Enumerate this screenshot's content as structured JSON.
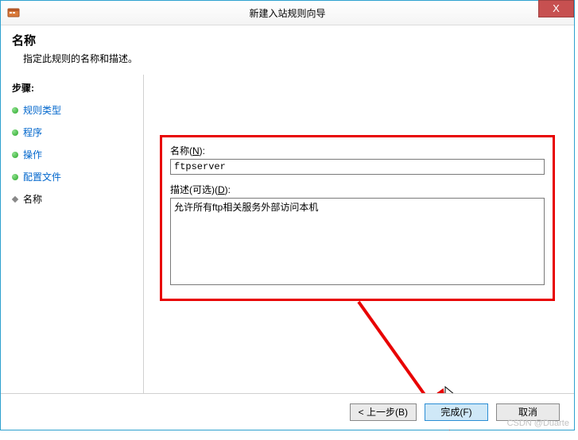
{
  "window": {
    "title": "新建入站规则向导",
    "close_label": "X"
  },
  "header": {
    "title": "名称",
    "subtitle": "指定此规则的名称和描述。"
  },
  "sidebar": {
    "title": "步骤:",
    "items": [
      {
        "label": "规则类型",
        "done": true
      },
      {
        "label": "程序",
        "done": true
      },
      {
        "label": "操作",
        "done": true
      },
      {
        "label": "配置文件",
        "done": true
      },
      {
        "label": "名称",
        "done": false,
        "current": true
      }
    ]
  },
  "form": {
    "name_label_pre": "名称(",
    "name_label_key": "N",
    "name_label_post": "):",
    "name_value": "ftpserver",
    "desc_label_pre": "描述(可选)(",
    "desc_label_key": "D",
    "desc_label_post": "):",
    "desc_value": "允许所有ftp相关服务外部访问本机"
  },
  "buttons": {
    "back": "< 上一步(B)",
    "finish": "完成(F)",
    "cancel": "取消"
  },
  "watermark": "CSDN @Duarte"
}
